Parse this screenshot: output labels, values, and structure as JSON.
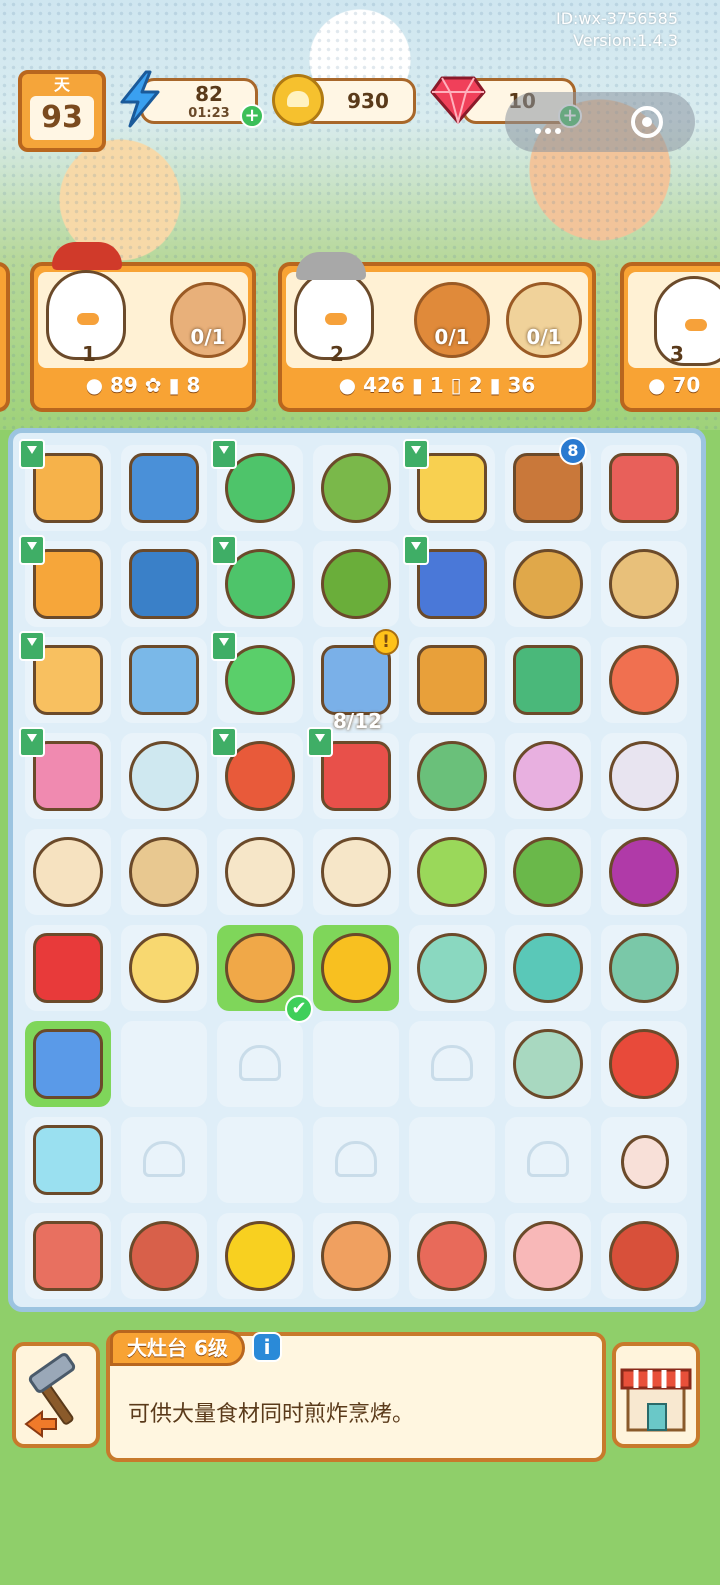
{
  "hud": {
    "id_text": "ID:wx-3756585",
    "version_text": "Version:1.4.3"
  },
  "day": {
    "label": "天",
    "number": "93"
  },
  "resources": {
    "energy": {
      "value": "82",
      "timer": "01:23"
    },
    "coins": {
      "value": "930"
    },
    "gems": {
      "value": "10"
    }
  },
  "orders": [
    {
      "hearts": "1",
      "dishes": [
        "0/1"
      ],
      "reward": [
        "89",
        "8"
      ]
    },
    {
      "hearts": "2",
      "dishes": [
        "0/1",
        "0/1"
      ],
      "reward": [
        "426",
        "1",
        "2",
        "36"
      ]
    },
    {
      "hearts": "3",
      "dishes": [],
      "reward": [
        "70"
      ]
    }
  ],
  "board": {
    "badge_count": "8",
    "progress": "8/12",
    "check_glyph": "✔",
    "alert_glyph": "!"
  },
  "info": {
    "title": "大灶台 6级",
    "info_glyph": "i",
    "description": "可供大量食材同时煎炸烹烤。"
  },
  "colors": {
    "order_orange": "#f8a334",
    "board_bg": "#dfeef8",
    "highlight_green": "#7fd65a"
  }
}
